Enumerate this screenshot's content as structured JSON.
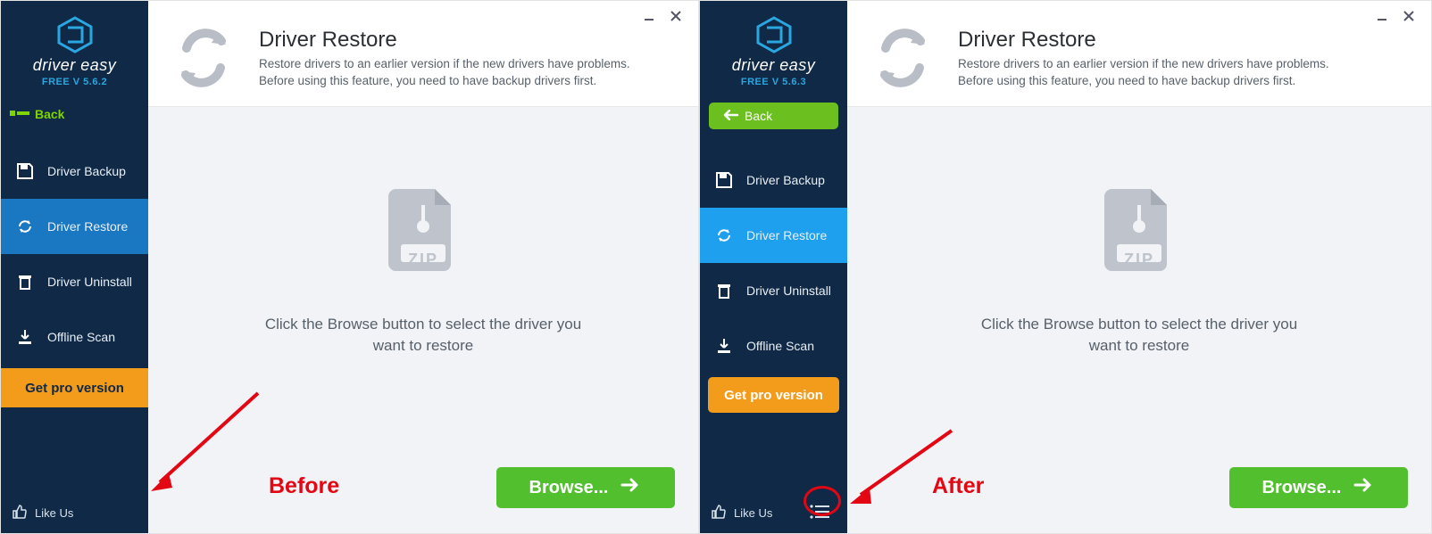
{
  "brand": "driver easy",
  "panels": {
    "before": {
      "version": "FREE V 5.6.2",
      "back_label": "Back",
      "nav": [
        {
          "label": "Driver Backup"
        },
        {
          "label": "Driver Restore"
        },
        {
          "label": "Driver Uninstall"
        },
        {
          "label": "Offline Scan"
        }
      ],
      "pro_label": "Get pro version",
      "like_label": "Like Us",
      "annotation": "Before"
    },
    "after": {
      "version": "FREE V 5.6.3",
      "back_label": "Back",
      "nav": [
        {
          "label": "Driver Backup"
        },
        {
          "label": "Driver Restore"
        },
        {
          "label": "Driver Uninstall"
        },
        {
          "label": "Offline Scan"
        }
      ],
      "pro_label": "Get pro version",
      "like_label": "Like Us",
      "annotation": "After"
    }
  },
  "main": {
    "title": "Driver Restore",
    "desc_line1": "Restore drivers to an earlier version if the new drivers have problems.",
    "desc_line2": "Before using this feature, you need to have backup drivers first.",
    "zip_caption_line1": "Click the Browse button to select the driver you",
    "zip_caption_line2": "want to restore",
    "zip_label": "ZIP",
    "browse_label": "Browse..."
  }
}
